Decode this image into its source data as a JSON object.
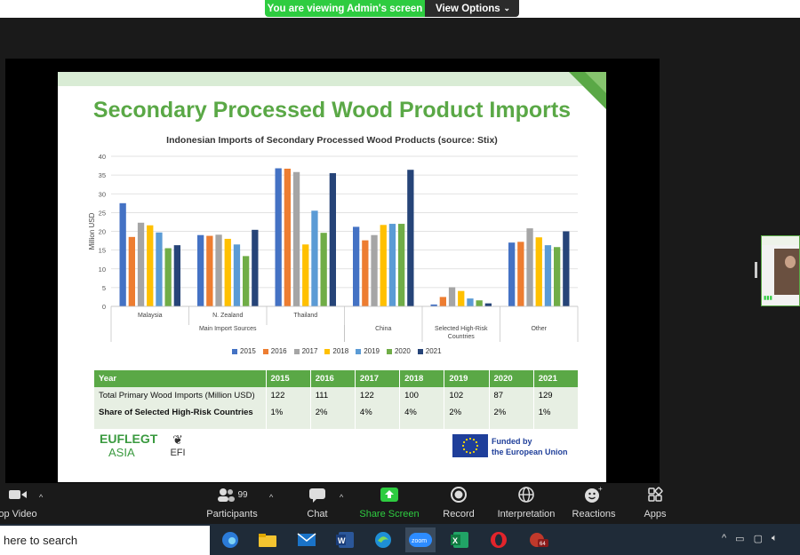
{
  "top_bar": {
    "viewing_text": "You are viewing Admin's screen",
    "view_options_label": "View Options"
  },
  "slide": {
    "title": "Secondary Processed Wood Product Imports",
    "chart_title": "Indonesian Imports of Secondary Processed Wood Products (source: Stix)",
    "logo_eu_line1": "EUFLEGT",
    "logo_eu_line2": "ASIA",
    "logo_efi": "EFI",
    "funded_line1": "Funded by",
    "funded_line2": "the European Union"
  },
  "chart_data": {
    "type": "bar",
    "ylabel": "Million USD",
    "ylim": [
      0,
      40
    ],
    "yticks": [
      0,
      5,
      10,
      15,
      20,
      25,
      30,
      35,
      40
    ],
    "categories": [
      "Malaysia",
      "N. Zealand",
      "Thailand",
      "China",
      "Selected High-Risk Countries",
      "Other"
    ],
    "group_label": "Main Import Sources",
    "series": [
      {
        "name": "2015",
        "color": "#4472c4",
        "values": [
          27.5,
          19,
          36.8,
          21.2,
          0.5,
          17
        ]
      },
      {
        "name": "2016",
        "color": "#ed7d31",
        "values": [
          18.5,
          18.8,
          36.7,
          17.6,
          2.5,
          17.2
        ]
      },
      {
        "name": "2017",
        "color": "#a5a5a5",
        "values": [
          22.3,
          19.1,
          35.8,
          19,
          5.1,
          20.8
        ]
      },
      {
        "name": "2018",
        "color": "#ffc000",
        "values": [
          21.6,
          18,
          16.5,
          21.7,
          4.1,
          18.4
        ]
      },
      {
        "name": "2019",
        "color": "#5b9bd5",
        "values": [
          19.7,
          16.5,
          25.5,
          22,
          2.1,
          16.3
        ]
      },
      {
        "name": "2020",
        "color": "#70ad47",
        "values": [
          15.5,
          13.4,
          19.6,
          22,
          1.6,
          15.8
        ]
      },
      {
        "name": "2021",
        "color": "#264478",
        "values": [
          16.3,
          20.4,
          35.5,
          36.4,
          0.8,
          20
        ]
      }
    ]
  },
  "table": {
    "header": [
      "Year",
      "2015",
      "2016",
      "2017",
      "2018",
      "2019",
      "2020",
      "2021"
    ],
    "rows": [
      [
        "Total Primary Wood Imports (Million USD)",
        "122",
        "111",
        "122",
        "100",
        "102",
        "87",
        "129"
      ],
      [
        "Share of Selected High-Risk Countries",
        "1%",
        "2%",
        "4%",
        "4%",
        "2%",
        "2%",
        "1%"
      ]
    ]
  },
  "toolbar": {
    "video": "op Video",
    "participants": "Participants",
    "participants_count": "99",
    "chat": "Chat",
    "share_screen": "Share Screen",
    "record": "Record",
    "interpretation": "Interpretation",
    "reactions": "Reactions",
    "apps": "Apps"
  },
  "taskbar": {
    "search_placeholder": "here to search",
    "opera_badge": "64"
  },
  "colors": {
    "accent_green": "#5aa846",
    "zoom_green": "#2ecc40"
  }
}
